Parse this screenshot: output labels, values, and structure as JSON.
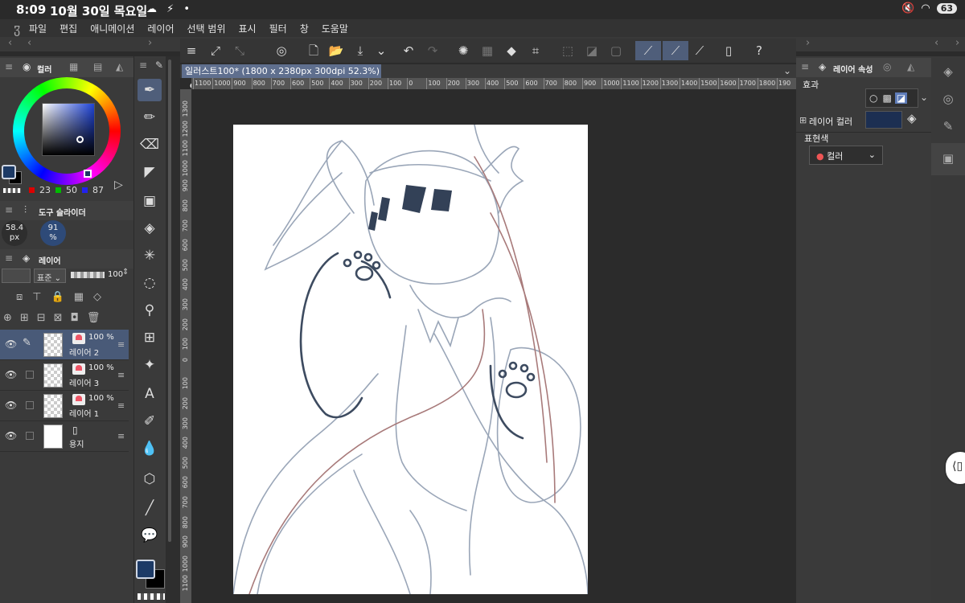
{
  "status": {
    "time": "8:09",
    "date": "10월 30일 목요일",
    "battery": "63"
  },
  "menu": [
    "파일",
    "편집",
    "애니메이션",
    "레이어",
    "선택 범위",
    "표시",
    "필터",
    "창",
    "도움말"
  ],
  "color_panel": {
    "tab_label": "컬러",
    "r": "23",
    "g": "50",
    "b": "87",
    "main_color": "#1c3a66"
  },
  "tool_slider": {
    "tab_label": "도구 슬라이더",
    "brush_size": "58.4",
    "brush_size_unit": "px",
    "opacity": "91",
    "opacity_unit": "%"
  },
  "layer_panel": {
    "tab_label": "레이어",
    "blend_mode": "표준",
    "opacity": "100",
    "layers": [
      {
        "name": "레이어 2",
        "opacity": "100 %",
        "selected": true
      },
      {
        "name": "레이어 3",
        "opacity": "100 %",
        "selected": false
      },
      {
        "name": "레이어 1",
        "opacity": "100 %",
        "selected": false
      },
      {
        "name": "용지",
        "opacity": "",
        "selected": false
      }
    ]
  },
  "document": {
    "tab_title": "일러스트100* (1800 x 2380px 300dpi 52.3%)"
  },
  "ruler": {
    "h_ticks": [
      "1100",
      "1000",
      "900",
      "800",
      "700",
      "600",
      "500",
      "400",
      "300",
      "200",
      "100",
      "0",
      "100",
      "200",
      "300",
      "400",
      "500",
      "600",
      "700",
      "800",
      "900",
      "1000",
      "1100",
      "1200",
      "1300",
      "1400",
      "1500",
      "1600",
      "1700",
      "1800",
      "190"
    ],
    "v_ticks": [
      "1300",
      "1200",
      "1100",
      "1000",
      "900",
      "800",
      "700",
      "600",
      "500",
      "400",
      "300",
      "200",
      "100",
      "0",
      "100",
      "200",
      "300",
      "400",
      "500",
      "600",
      "700",
      "800",
      "900",
      "1000",
      "1100"
    ]
  },
  "layer_property": {
    "tab_label": "레이어 속성",
    "effect_label": "효과",
    "layer_color_label": "레이어 컬러",
    "layer_color": "#1c2f52",
    "expression_color_label": "표현색",
    "expression_color_value": "컬러"
  }
}
